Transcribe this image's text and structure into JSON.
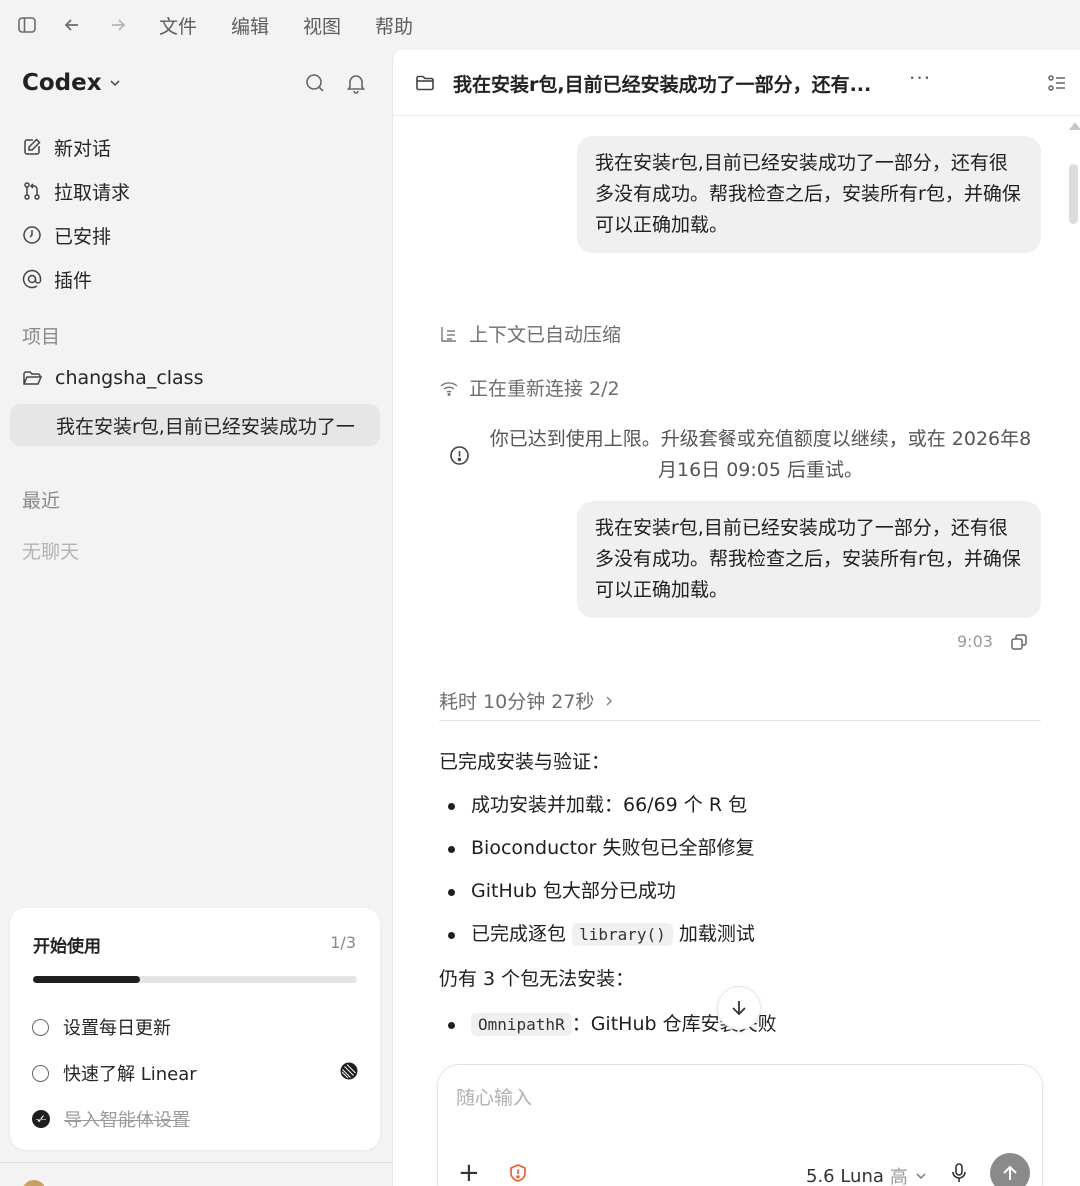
{
  "menubar": {
    "items": [
      "文件",
      "编辑",
      "视图",
      "帮助"
    ]
  },
  "sidebar": {
    "brand": "Codex",
    "nav": [
      {
        "label": "新对话",
        "icon": "edit-icon"
      },
      {
        "label": "拉取请求",
        "icon": "pull-request-icon"
      },
      {
        "label": "已安排",
        "icon": "clock-icon"
      },
      {
        "label": "插件",
        "icon": "at-icon"
      }
    ],
    "projects_label": "项目",
    "project_name": "changsha_class",
    "active_thread": "我在安装r包,目前已经安装成功了一",
    "recent_label": "最近",
    "recent_empty": "无聊天"
  },
  "onboarding": {
    "title": "开始使用",
    "count": "1/3",
    "progress": 0.33,
    "items": [
      {
        "label": "设置每日更新",
        "done": false
      },
      {
        "label": "快速了解 Linear",
        "done": false
      },
      {
        "label": "导入智能体设置",
        "done": true
      }
    ]
  },
  "thread": {
    "title": "我在安装r包,目前已经安装成功了一部分，还有...",
    "user_message_1": "我在安装r包,目前已经安装成功了一部分，还有很多没有成功。帮我检查之后，安装所有r包，并确保可以正确加载。",
    "status_compressed": "上下文已自动压缩",
    "status_reconnect": "正在重新连接 2/2",
    "limit_notice": "你已达到使用上限。升级套餐或充值额度以继续，或在 2026年8月16日 09:05 后重试。",
    "user_message_2": "我在安装r包,目前已经安装成功了一部分，还有很多没有成功。帮我检查之后，安装所有r包，并确保可以正确加载。",
    "message_time": "9:03",
    "elapsed": "耗时 10分钟 27秒",
    "reply": {
      "heading1": "已完成安装与验证：",
      "bullets": [
        "成功安装并加载：66/69 个 R 包",
        "Bioconductor 失败包已全部修复",
        "GitHub 包大部分已成功"
      ],
      "bullet4_pre": "已完成逐包",
      "bullet4_code": "library()",
      "bullet4_post": "加载测试",
      "heading2": "仍有 3 个包无法安装：",
      "fail1_code": "OmnipathR",
      "fail1_text": "：GitHub 仓库安装失败"
    }
  },
  "composer": {
    "placeholder": "随心输入",
    "model": "5.6 Luna",
    "effort": "高"
  }
}
